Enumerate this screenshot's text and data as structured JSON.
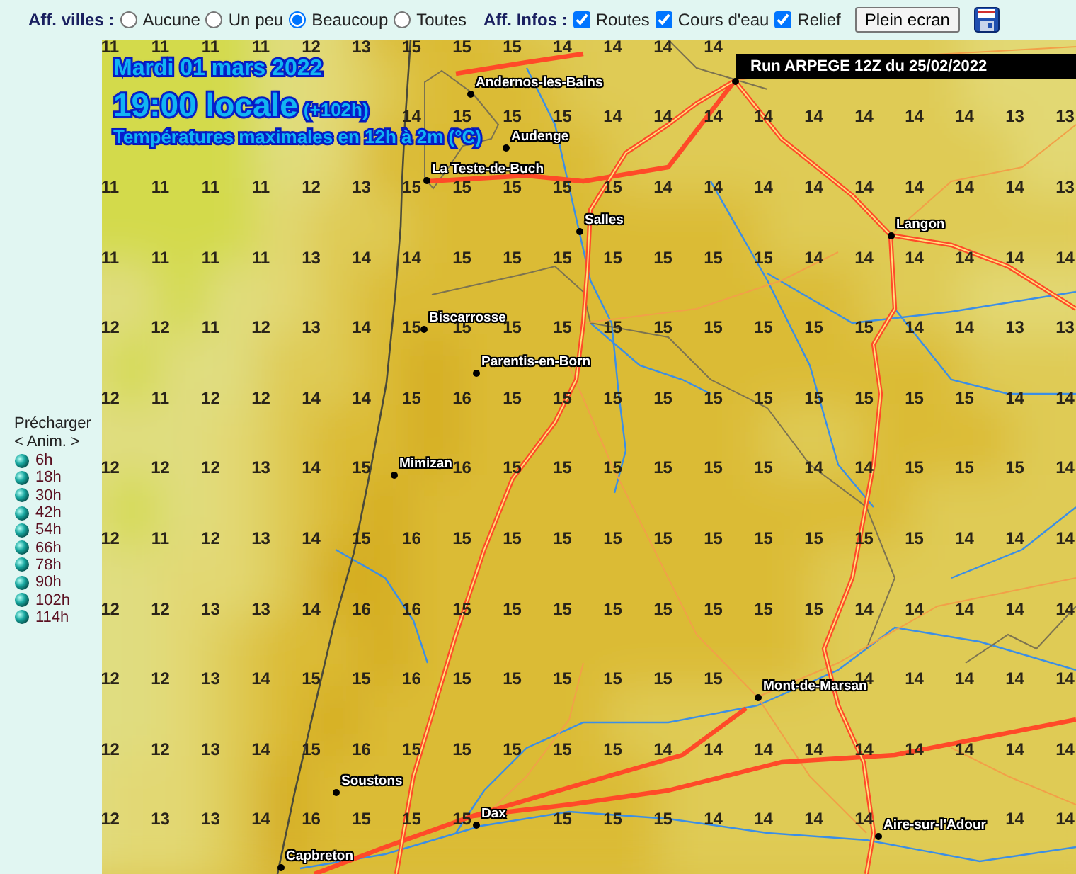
{
  "toolbar": {
    "cities_label": "Aff. villes :",
    "city_options": [
      {
        "label": "Aucune",
        "selected": false
      },
      {
        "label": "Un peu",
        "selected": false
      },
      {
        "label": "Beaucoup",
        "selected": true
      },
      {
        "label": "Toutes",
        "selected": false
      }
    ],
    "info_label": "Aff. Infos :",
    "info_options": [
      {
        "label": "Routes",
        "checked": true
      },
      {
        "label": "Cours d'eau",
        "checked": true
      },
      {
        "label": "Relief",
        "checked": true
      }
    ],
    "fullscreen_button": "Plein ecran"
  },
  "sidebar": {
    "preload": "Précharger",
    "anim": "< Anim. >",
    "steps": [
      "6h",
      "18h",
      "30h",
      "42h",
      "54h",
      "66h",
      "78h",
      "90h",
      "102h",
      "114h"
    ]
  },
  "map": {
    "date": "Mardi 01 mars 2022",
    "time": "19:00 locale",
    "offset": "(+102h)",
    "subtitle": "Températures maximales en 12h à 2m (°C)",
    "run": "Run ARPEGE 12Z du 25/02/2022",
    "cities": [
      "Andernos-les-Bains",
      "Audenge",
      "La Teste-de-Buch",
      "Salles",
      "Langon",
      "Biscarrosse",
      "Parentis-en-Born",
      "Mimizan",
      "Mont-de-Marsan",
      "Soustons",
      "Dax",
      "Aire-sur-l'Adour",
      "Capbreton"
    ],
    "grid": [
      [
        [
          "11",
          "11",
          "11",
          "11",
          "12",
          "13",
          "15",
          "15",
          "15",
          "14",
          "14",
          "14",
          "14"
        ]
      ],
      [
        [
          "14",
          "15",
          "15",
          "15",
          "14",
          "14",
          "14",
          "14",
          "14",
          "14",
          "14",
          "14",
          "13",
          "13"
        ]
      ],
      [
        [
          "11",
          "11",
          "11",
          "11",
          "12",
          "13",
          "15",
          "15",
          "15",
          "15",
          "15",
          "14",
          "14",
          "14",
          "14",
          "14",
          "14",
          "14",
          "14",
          "13"
        ]
      ],
      [
        [
          "11",
          "11",
          "11",
          "11",
          "13",
          "14",
          "14",
          "15",
          "15",
          "15",
          "15",
          "15",
          "15",
          "15",
          "14",
          "14",
          "14",
          "14",
          "14",
          "14"
        ]
      ],
      [
        [
          "12",
          "12",
          "11",
          "12",
          "13",
          "14",
          "15",
          "15",
          "15",
          "15",
          "15",
          "15",
          "15",
          "15",
          "15",
          "15",
          "14",
          "14",
          "13",
          "13"
        ]
      ],
      [
        [
          "12",
          "11",
          "12",
          "12",
          "14",
          "14",
          "15",
          "16",
          "15",
          "15",
          "15",
          "15",
          "15",
          "15",
          "15",
          "15",
          "15",
          "15",
          "14",
          "14"
        ]
      ],
      [
        [
          "12",
          "12",
          "12",
          "13",
          "14",
          "15"
        ],
        [
          "16",
          "15",
          "15",
          "15",
          "15",
          "15",
          "15",
          "14",
          "14",
          "15",
          "15",
          "15",
          "14"
        ]
      ],
      [
        [
          "12",
          "11",
          "12",
          "13",
          "14",
          "15",
          "16",
          "15",
          "15",
          "15",
          "15",
          "15",
          "15",
          "15",
          "15",
          "15",
          "15",
          "14",
          "14",
          "14"
        ]
      ],
      [
        [
          "12",
          "12",
          "13",
          "13",
          "14",
          "16",
          "16",
          "15",
          "15",
          "15",
          "15",
          "15",
          "15",
          "15",
          "15",
          "14",
          "14",
          "14",
          "14",
          "14"
        ]
      ],
      [
        [
          "12",
          "12",
          "13",
          "14",
          "15",
          "15",
          "16",
          "15",
          "15",
          "15",
          "15",
          "15",
          "15"
        ],
        [
          "14",
          "14",
          "14",
          "14",
          "14"
        ]
      ],
      [
        [
          "12",
          "12",
          "13",
          "14",
          "15",
          "16",
          "15",
          "15",
          "15",
          "15",
          "15",
          "14",
          "14",
          "14",
          "14",
          "14",
          "14",
          "14",
          "14",
          "14"
        ]
      ],
      [
        [
          "12",
          "13",
          "13",
          "14",
          "16",
          "15",
          "15",
          "15"
        ],
        [
          "15",
          "15",
          "15",
          "14",
          "14",
          "14",
          "14"
        ],
        [
          "14",
          "14"
        ]
      ]
    ]
  }
}
